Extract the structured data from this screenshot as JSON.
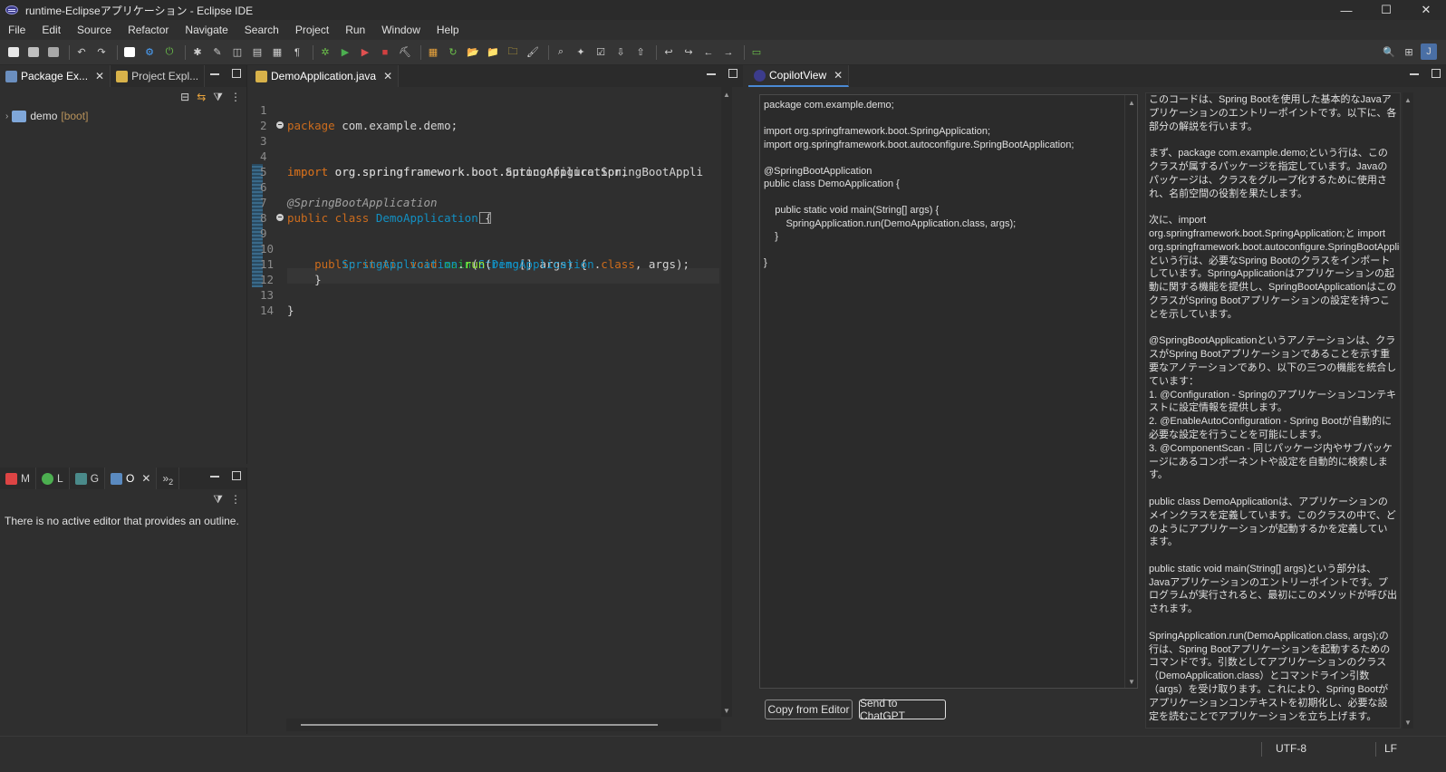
{
  "window": {
    "title": "runtime-Eclipseアプリケーション - Eclipse IDE",
    "minimize": "—",
    "maximize": "☐",
    "close": "✕"
  },
  "menu": [
    "File",
    "Edit",
    "Source",
    "Refactor",
    "Navigate",
    "Search",
    "Project",
    "Run",
    "Window",
    "Help"
  ],
  "left_top": {
    "tabs": [
      {
        "label": "Package Ex...",
        "close": "✕"
      },
      {
        "label": "Project Expl..."
      }
    ],
    "tree": [
      {
        "name": "demo",
        "suffix": "[boot]"
      }
    ]
  },
  "left_bottom": {
    "tabs": [
      {
        "label": "M"
      },
      {
        "label": "L"
      },
      {
        "label": "G"
      },
      {
        "label": "O",
        "close": "✕"
      },
      {
        "label": "»",
        "sub": "2"
      }
    ],
    "message": "There is no active editor that provides an outline."
  },
  "editor": {
    "tab": {
      "label": "DemoApplication.java",
      "close": "✕"
    },
    "lines": [
      {
        "n": "1"
      },
      {
        "n": "2"
      },
      {
        "n": "3"
      },
      {
        "n": "4"
      },
      {
        "n": "5"
      },
      {
        "n": "6"
      },
      {
        "n": "7"
      },
      {
        "n": "8"
      },
      {
        "n": "9"
      },
      {
        "n": "10"
      },
      {
        "n": "11"
      },
      {
        "n": "12"
      },
      {
        "n": "13"
      },
      {
        "n": "14"
      }
    ],
    "tokens": {
      "package_kw": "package",
      "package_name": " com.example.demo;",
      "import_kw": "import",
      "import1": " org.springframework.boot.SpringApplication;",
      "import2": " org.springframework.boot.autoconfigure.SpringBootAppli",
      "annotation": "@SpringBootApplication",
      "public_class": "public class ",
      "class_name": "DemoApplication",
      "brace_open": " {",
      "method_mods": "    public static void ",
      "method_name": "main",
      "paren_open": "(",
      "string_type": "String",
      "args_decl": "[] args) {",
      "indent8": "        ",
      "spring_app": "SpringApplication",
      "dot": ".",
      "run": "run",
      "demo_app": "DemoApplication",
      "class_kw": "class",
      "args_end": ", args);",
      "close4": "    }",
      "close0": "}"
    }
  },
  "copilot": {
    "tab": {
      "label": "CopilotView",
      "close": "✕"
    },
    "source_text": "package com.example.demo;\n\nimport org.springframework.boot.SpringApplication;\nimport org.springframework.boot.autoconfigure.SpringBootApplication;\n\n@SpringBootApplication\npublic class DemoApplication {\n\n    public static void main(String[] args) {\n        SpringApplication.run(DemoApplication.class, args);\n    }\n\n}",
    "explanation": "このコードは、Spring Bootを使用した基本的なJavaアプリケーションのエントリーポイントです。以下に、各部分の解説を行います。\n\nまず、package com.example.demo;という行は、このクラスが属するパッケージを指定しています。Javaのパッケージは、クラスをグループ化するために使用され、名前空間の役割を果たします。\n\n次に、import org.springframework.boot.SpringApplication;と import org.springframework.boot.autoconfigure.SpringBootApplication;という行は、必要なSpring Bootのクラスをインポートしています。SpringApplicationはアプリケーションの起動に関する機能を提供し、SpringBootApplicationはこのクラスがSpring Bootアプリケーションの設定を持つことを示しています。\n\n@SpringBootApplicationというアノテーションは、クラスがSpring Bootアプリケーションであることを示す重要なアノテーションであり、以下の三つの機能を統合しています：\n1. @Configuration - Springのアプリケーションコンテキストに設定情報を提供します。\n2. @EnableAutoConfiguration - Spring Bootが自動的に必要な設定を行うことを可能にします。\n3. @ComponentScan - 同じパッケージ内やサブパッケージにあるコンポーネントや設定を自動的に検索します。\n\npublic class DemoApplicationは、アプリケーションのメインクラスを定義しています。このクラスの中で、どのようにアプリケーションが起動するかを定義しています。\n\npublic static void main(String[] args)という部分は、Javaアプリケーションのエントリーポイントです。プログラムが実行されると、最初にこのメソッドが呼び出されます。\n\nSpringApplication.run(DemoApplication.class, args);の行は、Spring Bootアプリケーションを起動するためのコマンドです。引数としてアプリケーションのクラス（DemoApplication.class）とコマンドライン引数（args）を受け取ります。これにより、Spring Bootがアプリケーションコンテキストを初期化し、必要な設定を読むことでアプリケーションを立ち上げます。\n\nまとめると、このコードはSpring Bootを使用したシンプルなアプリケーションの基本的な構造を示しており、アプリケーションの開始点であるクラスを定義しています。",
    "copy_button": "Copy from Editor",
    "send_button": "Send to ChatGPT"
  },
  "status": {
    "encoding": "UTF-8",
    "line_ending": "LF"
  },
  "colors": {
    "keyword": "#cc6c1d",
    "class": "#1290c3",
    "annotation": "#a0a0a0",
    "background": "#2f2f2f"
  }
}
